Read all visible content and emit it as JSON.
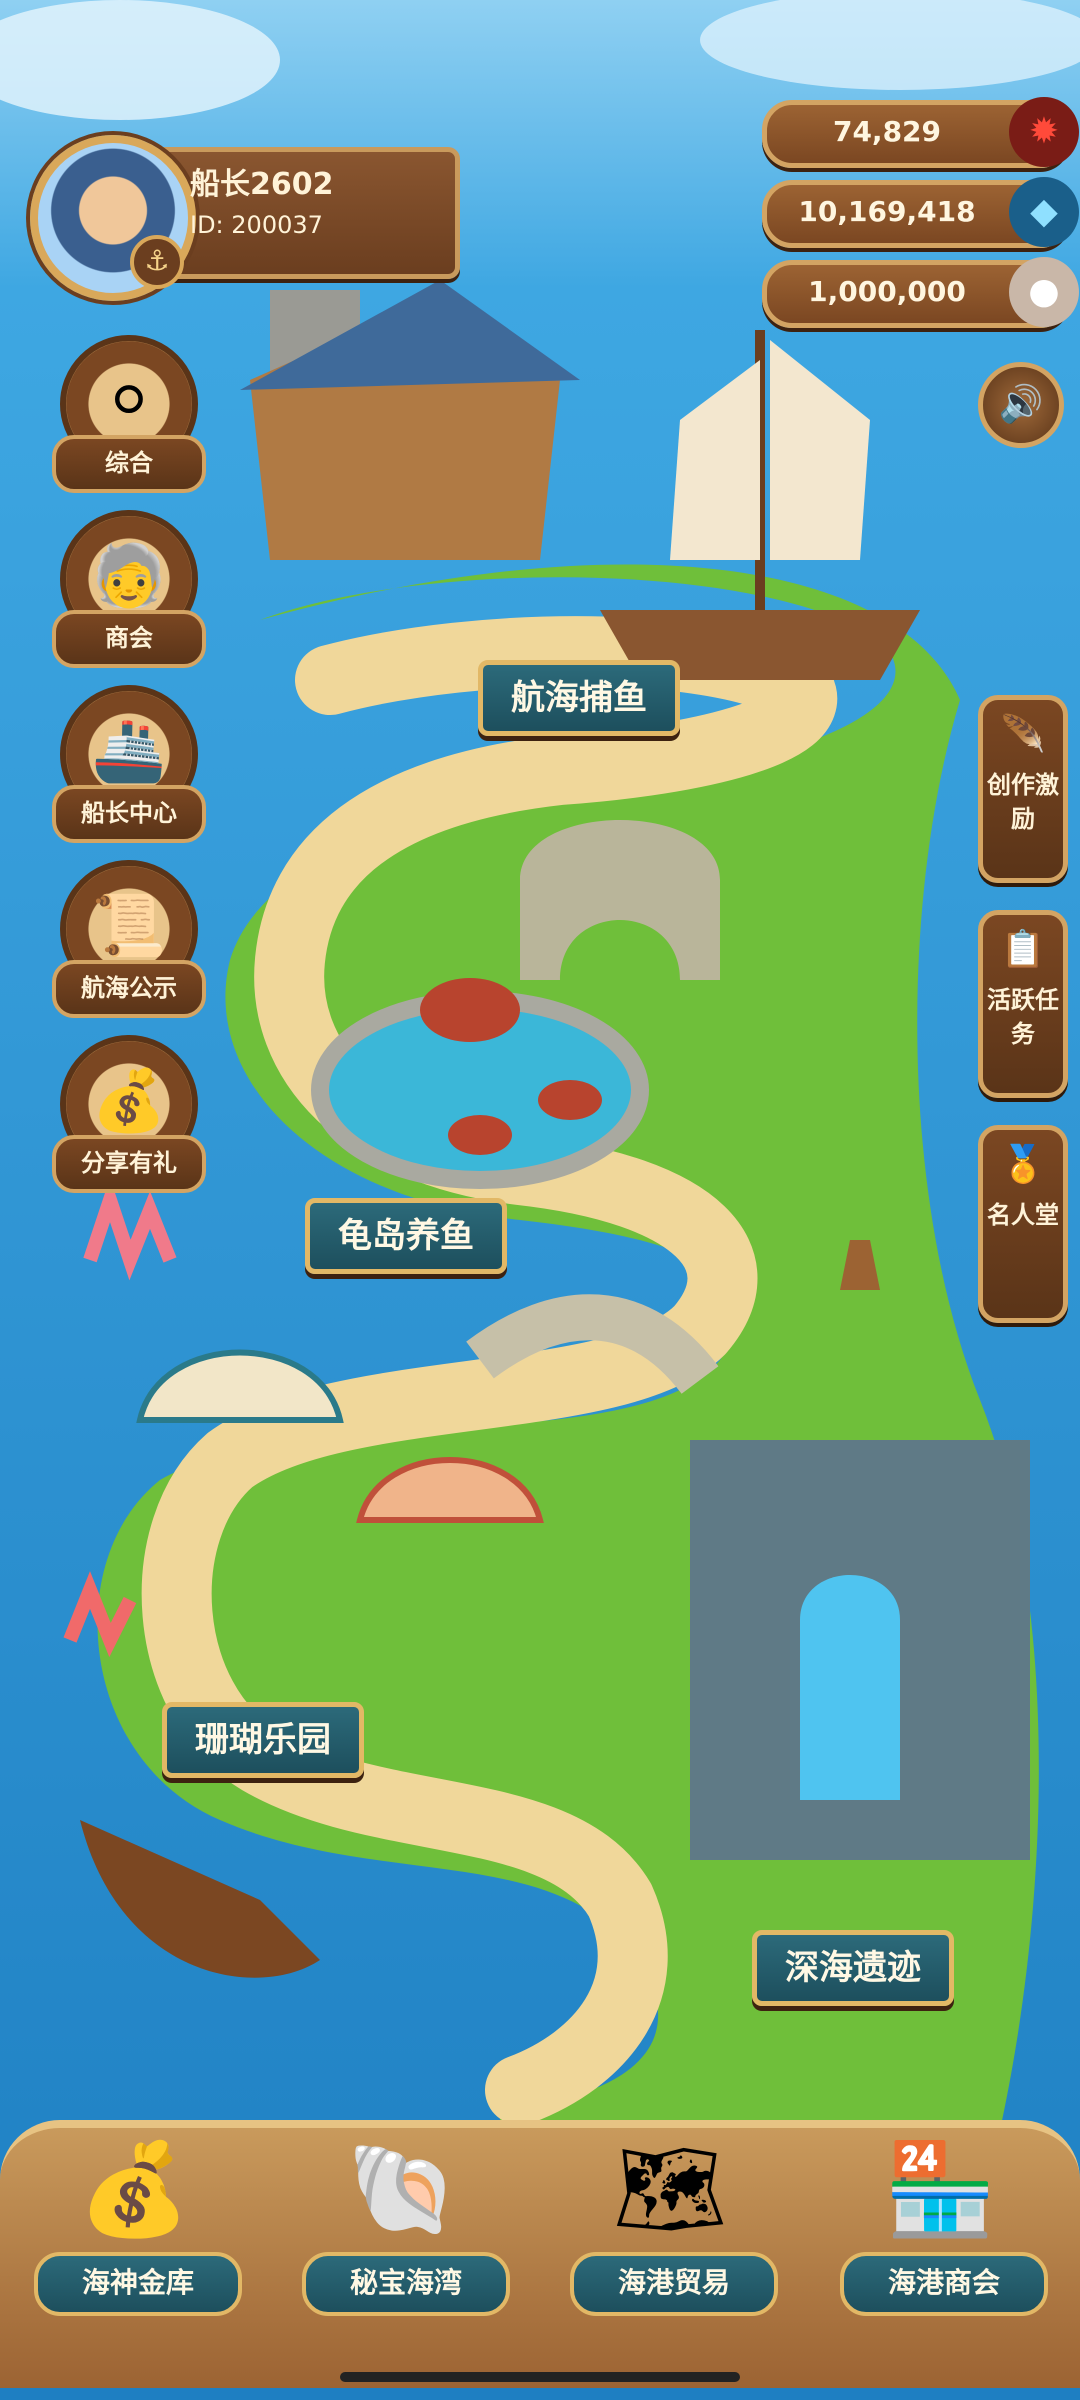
{
  "player": {
    "name": "船长2602",
    "id": "ID: 200037"
  },
  "currencies": [
    {
      "value": "74,829",
      "icon": "red-coral-icon",
      "color": "#e0362c"
    },
    {
      "value": "10,169,418",
      "icon": "blue-crystal-icon",
      "color": "#5cc8f0"
    },
    {
      "value": "1,000,000",
      "icon": "pearl-shell-icon",
      "color": "#f2e6dc"
    }
  ],
  "left_menu": [
    {
      "label": "综合",
      "icon": "pearl-pedestal-icon"
    },
    {
      "label": "商会",
      "icon": "old-captain-icon"
    },
    {
      "label": "船长中心",
      "icon": "cruise-ship-icon"
    },
    {
      "label": "航海公示",
      "icon": "scroll-notice-icon"
    },
    {
      "label": "分享有礼",
      "icon": "treasure-chest-icon"
    }
  ],
  "right_menu": [
    {
      "label": "创作激励",
      "icon": "feather-quill-icon"
    },
    {
      "label": "活跃任务",
      "icon": "task-scroll-icon"
    },
    {
      "label": "名人堂",
      "icon": "hall-of-fame-icon"
    }
  ],
  "sound": {
    "icon": "speaker-icon"
  },
  "zones": [
    {
      "label": "航海捕鱼"
    },
    {
      "label": "龟岛养鱼"
    },
    {
      "label": "珊瑚乐园"
    },
    {
      "label": "深海遗迹"
    }
  ],
  "bottom_nav": [
    {
      "label": "海神金库",
      "icon": "gold-chest-icon"
    },
    {
      "label": "秘宝海湾",
      "icon": "pearl-clam-icon"
    },
    {
      "label": "海港贸易",
      "icon": "trade-map-icon"
    },
    {
      "label": "海港商会",
      "icon": "harbor-shop-icon"
    }
  ],
  "colors": {
    "sea": "#2a8fd0",
    "sand": "#f0d79a",
    "grass": "#6fbf3a",
    "wood": "#7b4722",
    "gold_border": "#d3a463",
    "teal_label": "#1d4f5d"
  }
}
